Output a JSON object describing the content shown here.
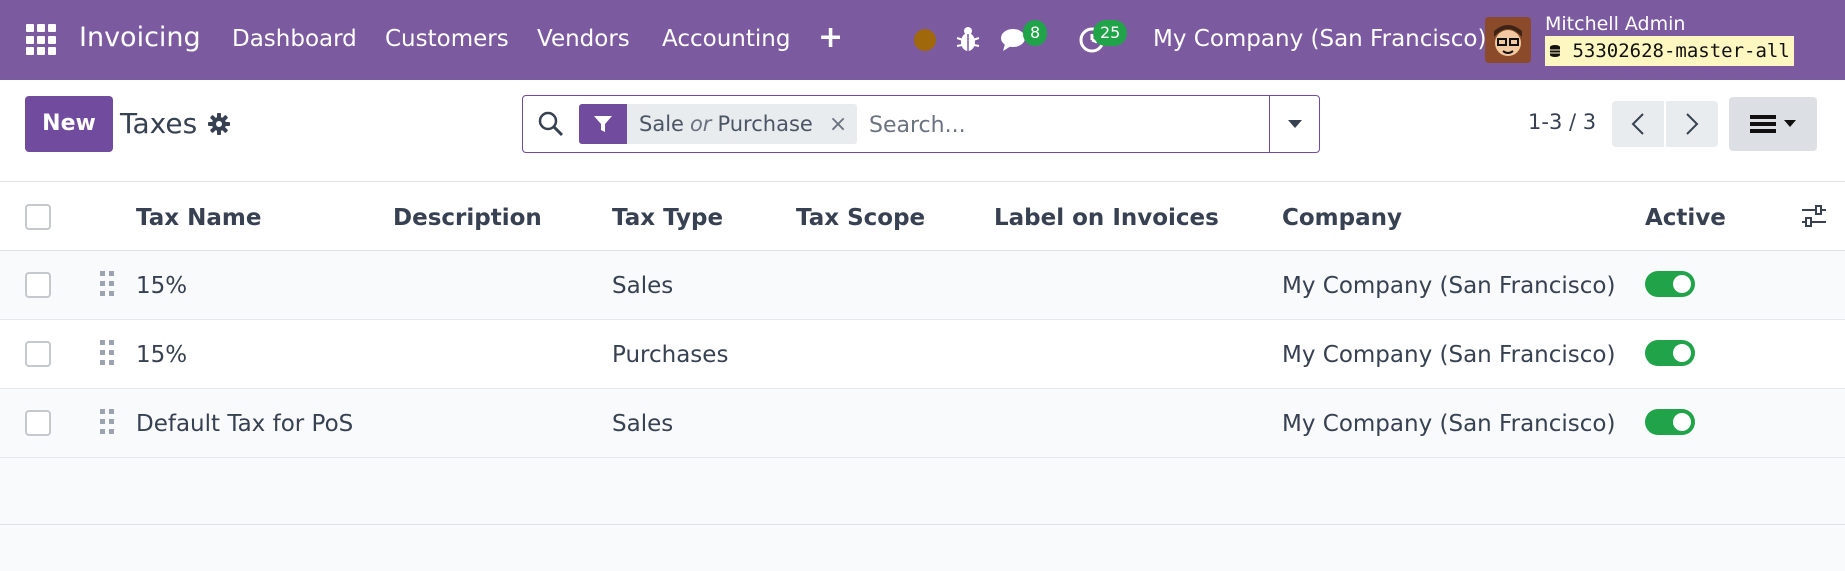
{
  "app": {
    "name": "Invoicing",
    "menu": [
      "Dashboard",
      "Customers",
      "Vendors",
      "Accounting"
    ],
    "chat_count": "8",
    "activity_count": "25",
    "company": "My Company (San Francisco)",
    "user_name": "Mitchell Admin",
    "database": "53302628-master-all"
  },
  "control": {
    "new_label": "New",
    "title": "Taxes",
    "facet_first": "Sale",
    "facet_or": "or",
    "facet_second": "Purchase",
    "facet_close": "×",
    "search_placeholder": "Search...",
    "pager": "1-3 / 3"
  },
  "table": {
    "columns": [
      "Tax Name",
      "Description",
      "Tax Type",
      "Tax Scope",
      "Label on Invoices",
      "Company",
      "Active"
    ],
    "rows": [
      {
        "name": "15%",
        "description": "",
        "type": "Sales",
        "scope": "",
        "label": "",
        "company": "My Company (San Francisco)",
        "active": true
      },
      {
        "name": "15%",
        "description": "",
        "type": "Purchases",
        "scope": "",
        "label": "",
        "company": "My Company (San Francisco)",
        "active": true
      },
      {
        "name": "Default Tax for PoS",
        "description": "",
        "type": "Sales",
        "scope": "",
        "label": "",
        "company": "My Company (San Francisco)",
        "active": true
      }
    ]
  },
  "colors": {
    "navbar": "#7c5aa0",
    "primary": "#714b9e",
    "toggle_on": "#21a34a",
    "badge": "#21a34a"
  },
  "icons": [
    "apps-grid-icon",
    "plus-icon",
    "status-dot-icon",
    "bug-icon",
    "chat-icon",
    "clock-icon",
    "settings-gear-icon",
    "search-icon",
    "filter-icon",
    "dropdown-caret-icon",
    "chevron-left-icon",
    "chevron-right-icon",
    "list-view-icon",
    "drag-handle-icon",
    "column-settings-icon"
  ]
}
